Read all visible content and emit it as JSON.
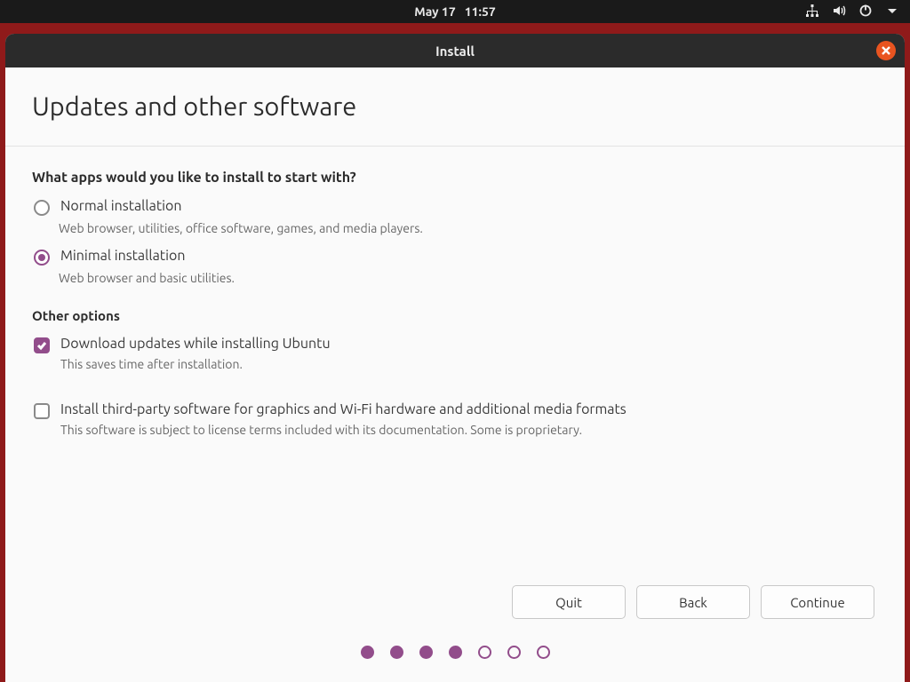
{
  "topbar": {
    "date": "May 17",
    "time": "11:57"
  },
  "window": {
    "title": "Install"
  },
  "page": {
    "heading": "Updates and other software",
    "question": "What apps would you like to install to start with?",
    "other_heading": "Other options"
  },
  "install_type": {
    "selected": "minimal",
    "normal": {
      "label": "Normal installation",
      "desc": "Web browser, utilities, office software, games, and media players."
    },
    "minimal": {
      "label": "Minimal installation",
      "desc": "Web browser and basic utilities."
    }
  },
  "other_options": {
    "download_updates": {
      "checked": true,
      "label": "Download updates while installing Ubuntu",
      "desc": "This saves time after installation."
    },
    "third_party": {
      "checked": false,
      "label": "Install third-party software for graphics and Wi-Fi hardware and additional media formats",
      "desc": "This software is subject to license terms included with its documentation. Some is proprietary."
    }
  },
  "buttons": {
    "quit": "Quit",
    "back": "Back",
    "continue": "Continue"
  },
  "progress": {
    "total": 7,
    "current": 4
  },
  "colors": {
    "accent": "#924d8b",
    "close": "#e95420",
    "desktop": "#8f1a1a"
  }
}
